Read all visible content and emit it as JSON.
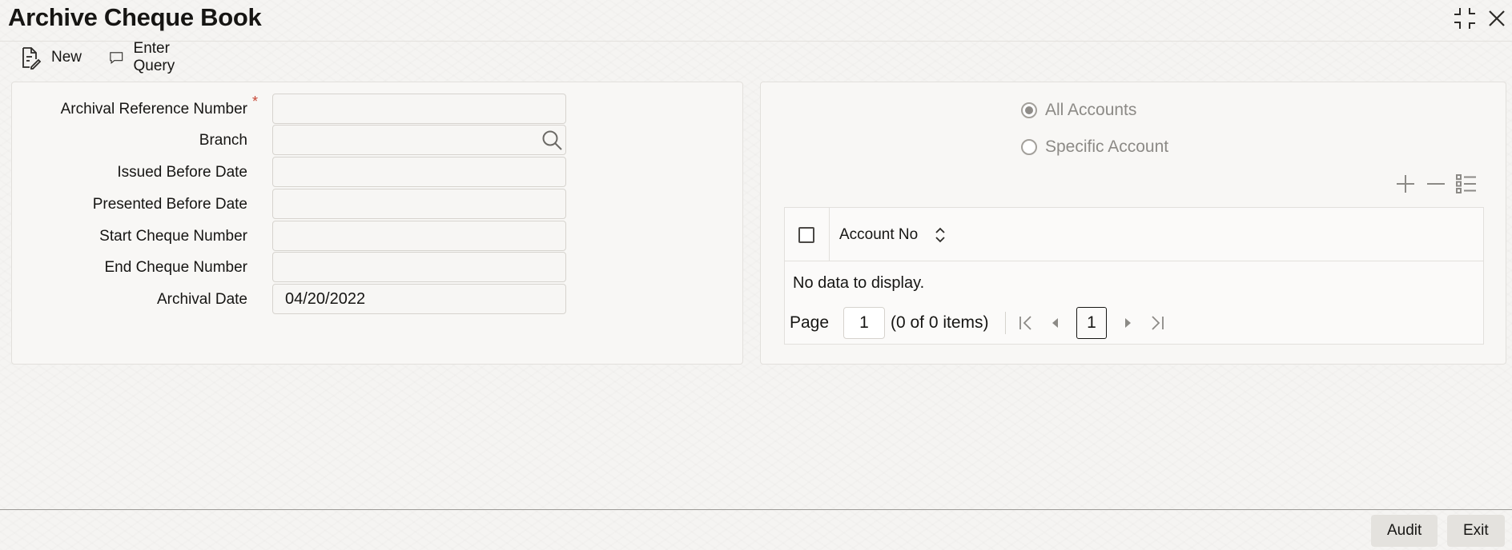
{
  "window": {
    "title": "Archive Cheque Book",
    "controls": [
      "minimize-icon",
      "close-icon"
    ]
  },
  "toolbar": {
    "new_label": "New",
    "enter_query_label": "Enter Query"
  },
  "form": {
    "archival_reference_number": {
      "label": "Archival Reference Number",
      "required_mark": "*",
      "value": ""
    },
    "branch": {
      "label": "Branch",
      "value": ""
    },
    "issued_before_date": {
      "label": "Issued Before Date",
      "value": ""
    },
    "presented_before_date": {
      "label": "Presented Before Date",
      "value": ""
    },
    "start_cheque_number": {
      "label": "Start Cheque Number",
      "value": ""
    },
    "end_cheque_number": {
      "label": "End Cheque Number",
      "value": ""
    },
    "archival_date": {
      "label": "Archival Date",
      "value": "04/20/2022"
    }
  },
  "accounts": {
    "options": [
      {
        "label": "All Accounts",
        "selected": true
      },
      {
        "label": "Specific Account",
        "selected": false
      }
    ],
    "table": {
      "columns": [
        "Account No"
      ],
      "rows": [],
      "empty_text": "No data to display."
    },
    "pager": {
      "page_label": "Page",
      "page_value": "1",
      "count_text": "(0 of 0 items)",
      "current_page": "1"
    }
  },
  "footer": {
    "audit_label": "Audit",
    "exit_label": "Exit"
  }
}
